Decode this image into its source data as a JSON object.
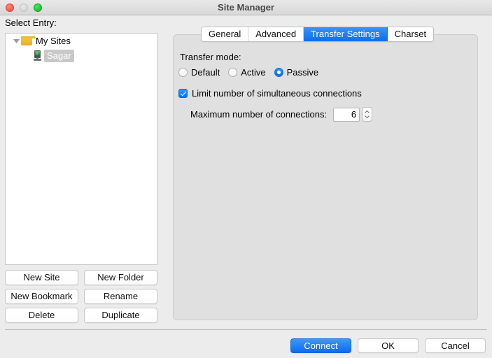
{
  "window": {
    "title": "Site Manager",
    "traffic_lights": [
      "close-button",
      "minimize-button",
      "zoom-button"
    ]
  },
  "sidebar": {
    "label": "Select Entry:",
    "tree": [
      {
        "label": "My Sites",
        "icon": "folder-icon",
        "level": 0,
        "expanded": true,
        "selected": false
      },
      {
        "label": "Sagar",
        "icon": "server-icon",
        "level": 1,
        "expanded": false,
        "selected": true
      }
    ],
    "buttons": [
      {
        "label": "New Site"
      },
      {
        "label": "New Folder"
      },
      {
        "label": "New Bookmark"
      },
      {
        "label": "Rename"
      },
      {
        "label": "Delete"
      },
      {
        "label": "Duplicate"
      }
    ]
  },
  "tabs": [
    {
      "label": "General",
      "active": false
    },
    {
      "label": "Advanced",
      "active": false
    },
    {
      "label": "Transfer Settings",
      "active": true
    },
    {
      "label": "Charset",
      "active": false
    }
  ],
  "transfer_settings": {
    "transfer_mode_label": "Transfer mode:",
    "modes": [
      {
        "label": "Default",
        "selected": false
      },
      {
        "label": "Active",
        "selected": false
      },
      {
        "label": "Passive",
        "selected": true
      }
    ],
    "limit_connections": {
      "label": "Limit number of simultaneous connections",
      "checked": true
    },
    "max_connections": {
      "label": "Maximum number of connections:",
      "value": "6"
    }
  },
  "footer": {
    "buttons": [
      {
        "label": "Connect",
        "default": true
      },
      {
        "label": "OK",
        "default": false
      },
      {
        "label": "Cancel",
        "default": false
      }
    ]
  },
  "colors": {
    "accent": "#0a6ef0",
    "window_background": "#ececec",
    "panel_background": "#e0e0e0",
    "selection_inactive": "#c8c8c8"
  }
}
